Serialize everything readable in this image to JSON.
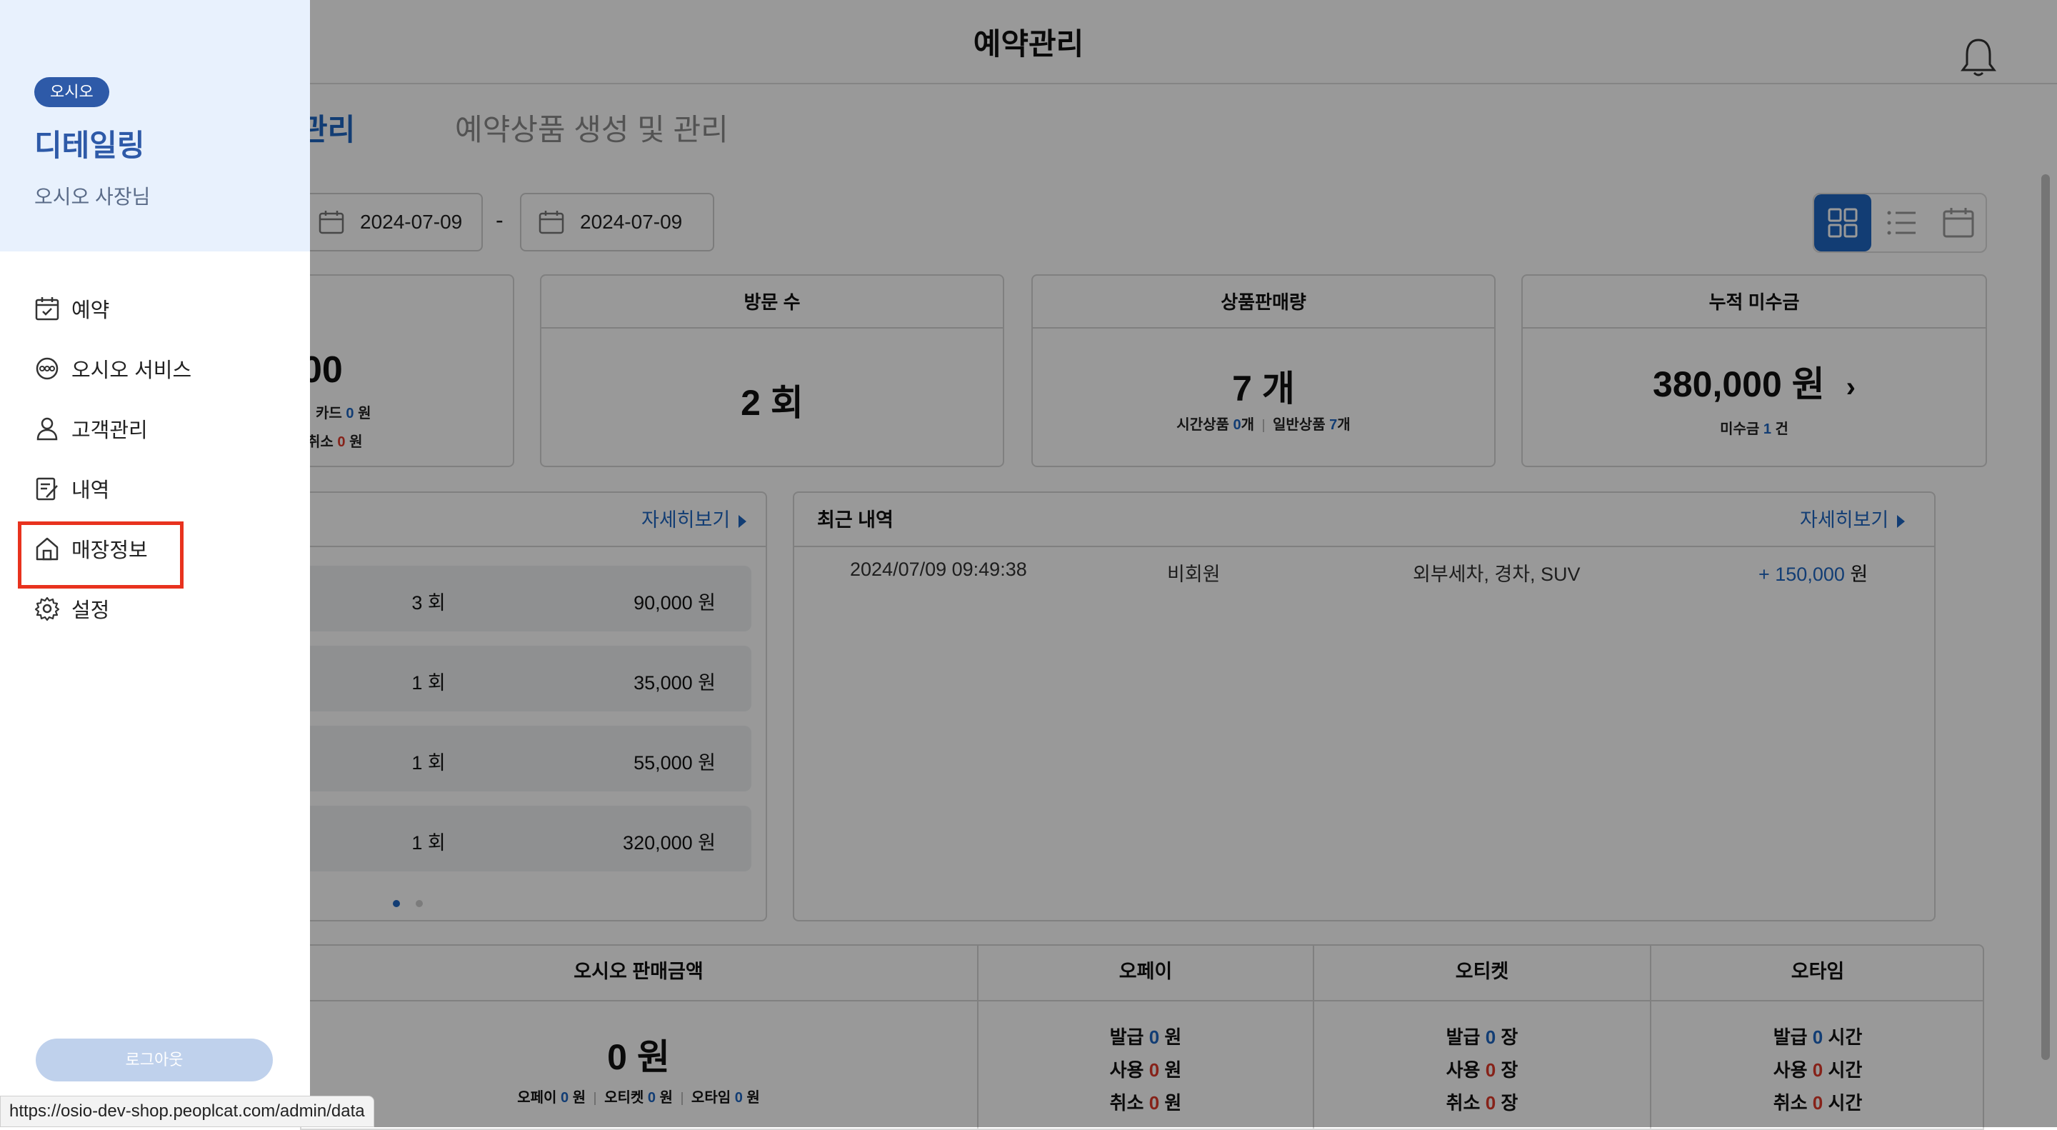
{
  "header": {
    "title": "예약관리"
  },
  "tabs": [
    {
      "label": "관리"
    },
    {
      "label": "예약상품 생성 및 관리"
    }
  ],
  "date_range": {
    "start": "2024-07-09",
    "separator": "-",
    "end": "2024-07-09"
  },
  "summary_cards": {
    "sales": {
      "amount_partial": "00",
      "card_label": "카드",
      "card_value": "0",
      "card_unit": "원",
      "cancel_label": "취소",
      "cancel_value": "0",
      "cancel_unit": "원"
    },
    "visits": {
      "title": "방문 수",
      "value": "2 회"
    },
    "products_sold": {
      "title": "상품판매량",
      "value": "7 개",
      "time_label": "시간상품",
      "time_value": "0",
      "time_unit": "개",
      "general_label": "일반상품",
      "general_value": "7",
      "general_unit": "개"
    },
    "unpaid": {
      "title": "누적 미수금",
      "value": "380,000 원",
      "sub_label": "미수금",
      "sub_value": "1",
      "sub_unit": "건"
    }
  },
  "product_list": {
    "more_label": "자세히보기",
    "rows": [
      {
        "count": "3 회",
        "amount": "90,000 원"
      },
      {
        "count": "1 회",
        "amount": "35,000 원"
      },
      {
        "count": "1 회",
        "amount": "55,000 원"
      },
      {
        "count": "1 회",
        "amount": "320,000 원"
      }
    ]
  },
  "recent": {
    "title": "최근 내역",
    "more_label": "자세히보기",
    "rows": [
      {
        "datetime": "2024/07/09 09:49:38",
        "member": "비회원",
        "services": "외부세차, 경차, SUV",
        "amount": "+ 150,000",
        "unit": "원"
      }
    ]
  },
  "osio_sales": {
    "title": "오시오 판매금액",
    "value": "0 원",
    "opay_label": "오페이",
    "opay_value": "0",
    "opay_unit": "원",
    "oticket_label": "오티켓",
    "oticket_value": "0",
    "oticket_unit": "원",
    "otime_label": "오타임",
    "otime_value": "0",
    "otime_unit": "원"
  },
  "opay": {
    "title": "오페이",
    "issue_label": "발급",
    "issue_value": "0",
    "use_label": "사용",
    "use_value": "0",
    "cancel_label": "취소",
    "cancel_value": "0",
    "unit": "원"
  },
  "oticket": {
    "title": "오티켓",
    "issue_label": "발급",
    "issue_value": "0",
    "use_label": "사용",
    "use_value": "0",
    "cancel_label": "취소",
    "cancel_value": "0",
    "unit": "장"
  },
  "otime": {
    "title": "오타임",
    "issue_label": "발급",
    "issue_value": "0",
    "use_label": "사용",
    "use_value": "0",
    "cancel_label": "취소",
    "cancel_value": "0",
    "unit": "시간"
  },
  "drawer": {
    "badge": "오시오",
    "shop_name": "디테일링",
    "owner": "오시오 사장님",
    "menu": [
      {
        "label": "예약",
        "icon": "calendar-icon"
      },
      {
        "label": "오시오 서비스",
        "icon": "osio-service-icon"
      },
      {
        "label": "고객관리",
        "icon": "person-icon"
      },
      {
        "label": "내역",
        "icon": "history-icon"
      },
      {
        "label": "매장정보",
        "icon": "store-icon"
      },
      {
        "label": "설정",
        "icon": "gear-icon"
      }
    ],
    "logout": "로그아웃"
  },
  "status_bar": {
    "url": "https://osio-dev-shop.peoplcat.com/admin/data"
  },
  "colors": {
    "accent": "#1f66c1",
    "negative": "#e03a2b",
    "highlight": "#e8321e",
    "drawer_head": "#e8f1fd",
    "badge": "#2e5aa8"
  }
}
